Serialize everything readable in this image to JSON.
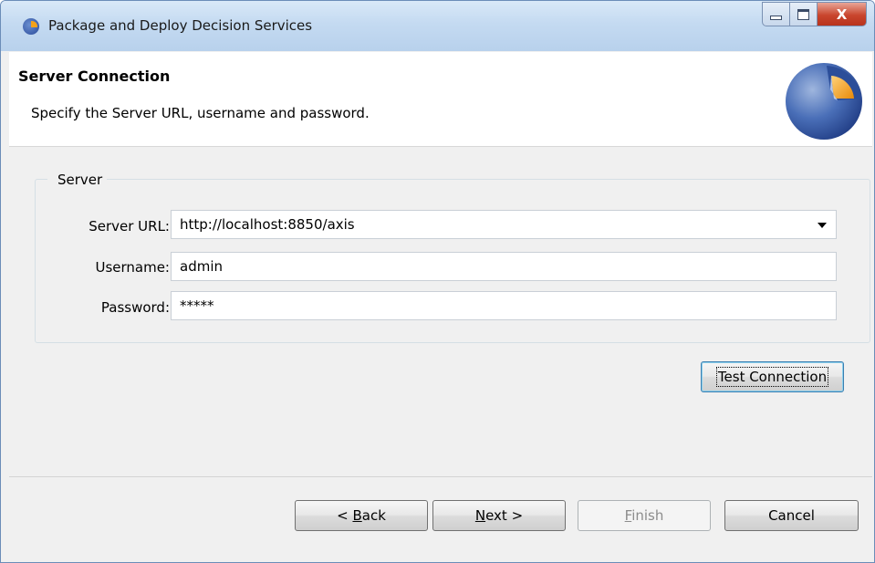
{
  "window": {
    "title": "Package and Deploy Decision Services",
    "controls": [
      "minimize",
      "maximize",
      "close"
    ],
    "close_glyph": "X"
  },
  "banner": {
    "title": "Server Connection",
    "description": "Specify the Server URL, username and password.",
    "logo_icon": "pie-logo-icon"
  },
  "server_group": {
    "label": "Server",
    "url_label": "Server URL:",
    "url_value": "http://localhost:8850/axis",
    "username_label": "Username:",
    "username_value": "admin",
    "password_label": "Password:",
    "password_value": "*****"
  },
  "test_connection_label": "Test Connection",
  "footer": {
    "back": {
      "prefix": "< ",
      "mnemonic": "B",
      "rest": "ack"
    },
    "next": {
      "mnemonic": "N",
      "rest": "ext >"
    },
    "finish": {
      "mnemonic": "F",
      "rest": "inish"
    },
    "cancel": "Cancel"
  },
  "colors": {
    "title_bar": "#c4daf1",
    "close_button": "#c9452d",
    "logo_blue": "#2a4a9a",
    "logo_orange": "#f4a21a",
    "focus_border": "#3c7fb1"
  }
}
